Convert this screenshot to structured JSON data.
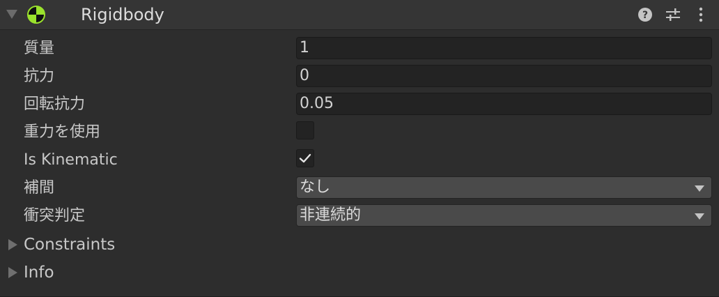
{
  "header": {
    "title": "Rigidbody",
    "icons": [
      "rigidbody-component-icon",
      "help-icon",
      "preset-icon",
      "menu-icon"
    ]
  },
  "fields": {
    "mass": {
      "label": "質量",
      "value": "1"
    },
    "drag": {
      "label": "抗力",
      "value": "0"
    },
    "angular_drag": {
      "label": "回転抗力",
      "value": "0.05"
    },
    "use_gravity": {
      "label": "重力を使用",
      "checked": false
    },
    "is_kinematic": {
      "label": "Is Kinematic",
      "checked": true
    },
    "interpolate": {
      "label": "補間",
      "selected": "なし"
    },
    "collision_detection": {
      "label": "衝突判定",
      "selected": "非連続的"
    }
  },
  "foldouts": {
    "constraints": "Constraints",
    "info": "Info"
  },
  "colors": {
    "background": "#2d2d2d",
    "header": "#353535",
    "field": "#232323",
    "dropdown": "#4a4a4a",
    "icon_accent": "#9be22d"
  }
}
